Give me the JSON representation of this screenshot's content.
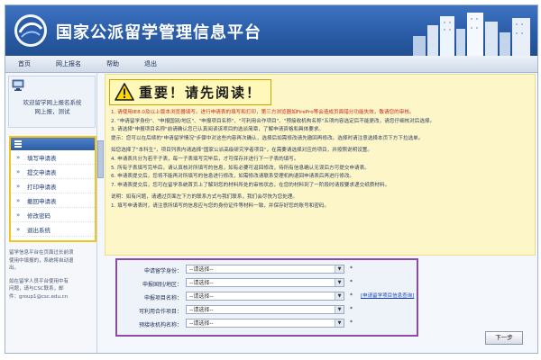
{
  "banner": {
    "title": "国家公派留学管理信息平台"
  },
  "nav": {
    "items": [
      "首页",
      "网上报名",
      "帮助",
      "退出"
    ]
  },
  "sidebar": {
    "welcome": [
      "欢迎留学网上报名系统",
      "网上报，测试"
    ],
    "menu": [
      "填写申请表",
      "提交申请表",
      "打印申请表",
      "撤回申请表",
      "修改密码",
      "退出系统"
    ],
    "note": [
      "留学信息平台在页面过长前须",
      "使用中填报的，系统将自动退",
      "出。",
      "",
      "如在留学人员平台使用中有",
      "问题，请与CSC联系，邮",
      "件：group1@csc.edu.cn"
    ]
  },
  "notice": {
    "title": "重要！请先阅读！",
    "lines": [
      {
        "text": "1. 请使用IE8.0及以上版本浏览器填写。进行申请表的填写和打印，第三方浏览器如FirePro等会造成页面错分功能失效，敬请您的审核。",
        "color": "red"
      },
      {
        "text": "2. \"申请留学身份\"、\"申报国别/地区\"、\"申报项目名称\"、\"可利用合作项目\"、\"预接收机构名称\"五项内容选定后不能更改，请您仔细核对后选择。",
        "color": "normal"
      },
      {
        "text": "3. 请选择\"申报项目名称\"前请确认您已认真阅读该项目的选派简章，了解申请资格和具体要求。",
        "color": "normal"
      },
      {
        "text": "   提示：您可以在后续的\"申请留学情况\"步骤中对这些内容再次确认，选择后如需修改请先撤回再修改。选择时请注意选择本页下方下拉选单。",
        "color": "normal"
      },
      {
        "text": "",
        "color": "spacer"
      },
      {
        "text": "   如您选择了\"本科生\"，项目列表内请选择\"国家公派高级研究学者项目\"，在需要请选择对应的项目，并按照说明设置。",
        "color": "normal"
      },
      {
        "text": "4. 申请表共分为若干子表，每一子表填写完毕后，才可保存并进行下一子表的填写。",
        "color": "normal"
      },
      {
        "text": "5. 所有子表填写完毕后，请认真核对所填写的信息，如有必要可返回修改，待所有信息确认无误后方可提交申请表。",
        "color": "normal"
      },
      {
        "text": "6. 申请表提交后，您将不能再对所填写的信息进行修改，如需修改请联系受理机构退回申请表后再进行修改。",
        "color": "normal"
      },
      {
        "text": "7. 申请表提交后，您可在留学系统首页上了解到您的材料所处的审核状态，在您的材料到了一阶段时请按要求递交纸质材料。",
        "color": "normal"
      },
      {
        "text": "",
        "color": "spacer"
      },
      {
        "text": "   说明：如有问题，请通过页面左下方的联系方式与我们联系，我们会尽快为您处理。",
        "color": "normal"
      },
      {
        "text": "1. 填写申请表时，请注意所填写的信息应与您的身份证件等材料一致，并保存好您的账号和密码。",
        "color": "normal"
      }
    ]
  },
  "form": {
    "rows": [
      {
        "label": "申请留学身份：",
        "value": "--请选择--"
      },
      {
        "label": "申报国别/地区：",
        "value": "--请选择--"
      },
      {
        "label": "申报项目名称：",
        "value": "--请选择--"
      },
      {
        "label": "可利用合作项目：",
        "value": "--请选择--"
      },
      {
        "label": "预接收机构名称：",
        "value": "--请选择--"
      }
    ],
    "search_link": "[申请留学项目信息查询]",
    "next_label": "下一步"
  }
}
